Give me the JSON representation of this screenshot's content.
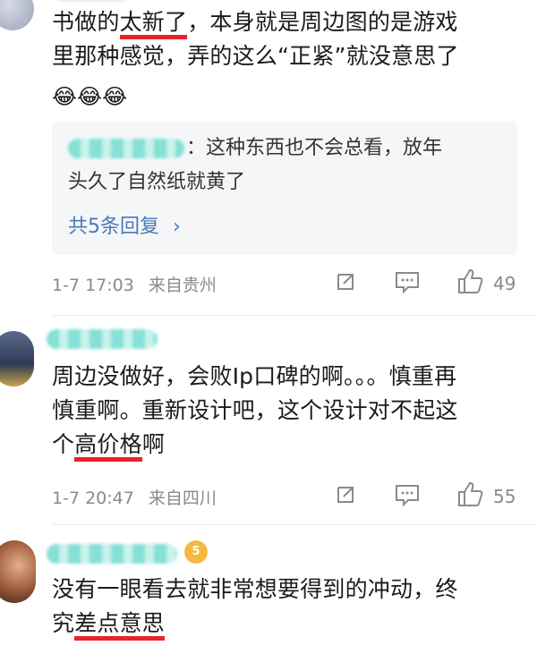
{
  "comments": [
    {
      "text_lines": [
        "书做的",
        "太新了",
        "，本身就是周边图的是游戏",
        "里那种感觉，弄的这么“正紧”就没意思了"
      ],
      "emojis": [
        "😂",
        "😂",
        "😂"
      ],
      "reply": {
        "text_line1": "：这种东西也不会总看，放年",
        "text_line2": "头久了自然纸就黄了",
        "more": "共5条回复",
        "more_arrow": "›"
      },
      "time": "1-7 17:03",
      "location": "来自贵州",
      "likes": "49"
    },
    {
      "text_line1": "周边没做好，会败Ip口碑的啊。。。慎重再",
      "text_line2": "慎重啊。重新设计吧，这个设计对不起这",
      "text_line3_pre": "个",
      "text_line3_underlined": "高价格",
      "text_line3_post": "啊",
      "time": "1-7 20:47",
      "location": "来自四川",
      "likes": "55"
    },
    {
      "text_line1": "没有一眼看去就非常想要得到的冲动，终",
      "text_line2_pre": "究",
      "text_line2_underlined": "差点意思",
      "badge": "5"
    }
  ],
  "colors": {
    "underline": "#e6232a",
    "link": "#4a79b9",
    "meta": "#8a8a8a",
    "blur_name": "#86e0d6"
  }
}
